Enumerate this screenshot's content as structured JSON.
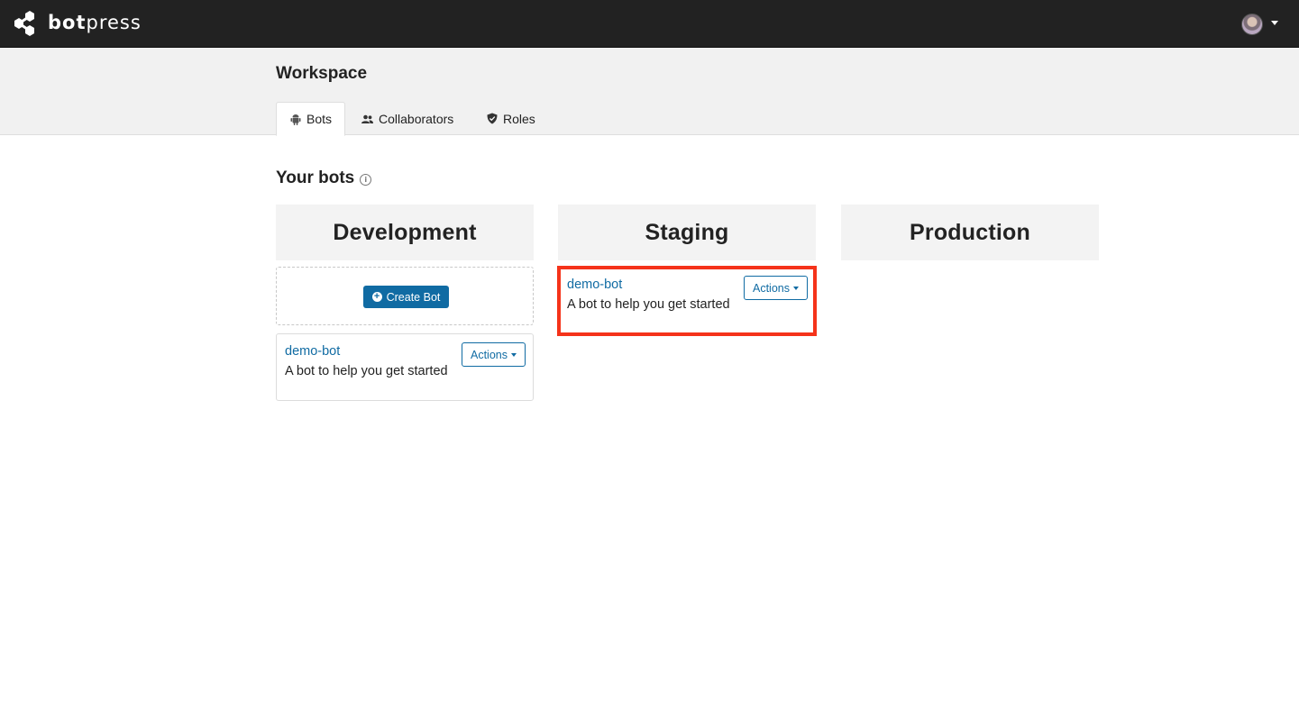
{
  "app": {
    "brand_part1": "bot",
    "brand_part2": "press"
  },
  "header": {
    "title": "Workspace",
    "tabs": [
      {
        "label": "Bots",
        "icon": "android-icon",
        "active": true
      },
      {
        "label": "Collaborators",
        "icon": "users-icon",
        "active": false
      },
      {
        "label": "Roles",
        "icon": "shield-icon",
        "active": false
      }
    ]
  },
  "main": {
    "section_title": "Your bots",
    "stages": [
      {
        "name": "Development"
      },
      {
        "name": "Staging"
      },
      {
        "name": "Production"
      }
    ],
    "create_bot_label": "Create Bot",
    "bots": [
      {
        "stage": "Development",
        "name": "demo-bot",
        "description": "A bot to help you get started",
        "actions_label": "Actions"
      },
      {
        "stage": "Staging",
        "name": "demo-bot",
        "description": "A bot to help you get started",
        "actions_label": "Actions",
        "highlighted": true
      }
    ]
  },
  "colors": {
    "accent": "#106ba3",
    "topbar": "#222222",
    "highlight": "#f5331a"
  }
}
